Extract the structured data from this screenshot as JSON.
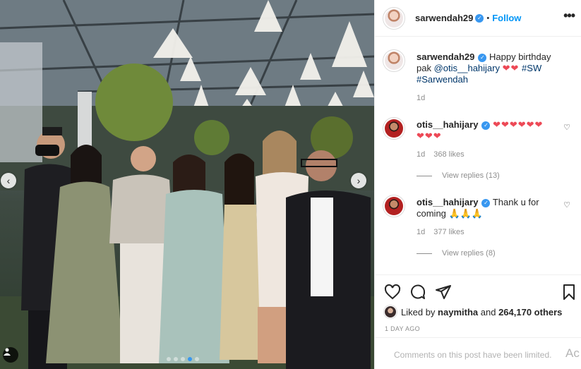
{
  "post": {
    "username": "sarwendah29",
    "separator": "•",
    "follow_label": "Follow",
    "more_icon": "more-options-icon"
  },
  "carousel": {
    "prev_glyph": "‹",
    "next_glyph": "›",
    "slide_count": 5,
    "active_index": 3
  },
  "comments": [
    {
      "username": "sarwendah29",
      "text_prefix": "Happy birthday pak ",
      "mention": "@otis__hahijary",
      "hearts": "❤❤",
      "hashtags": "#SW #Sarwendah",
      "time": "1d"
    },
    {
      "username": "otis__hahijary",
      "hearts": "❤❤❤❤❤❤❤❤❤",
      "time": "1d",
      "likes": "368 likes",
      "replies": "View replies (13)"
    },
    {
      "username": "otis__hahijary",
      "text": "Thank u for coming",
      "emoji": "🙏🙏🙏",
      "time": "1d",
      "likes": "377 likes",
      "replies": "View replies (8)"
    }
  ],
  "engagement": {
    "liked_by_prefix": "Liked by",
    "liked_by_user": "naymitha",
    "liked_by_and": "and",
    "others": "264,170 others",
    "time_ago": "1 DAY AGO"
  },
  "comment_box": {
    "limited_text": "Comments on this post have been limited."
  },
  "watermark": "Ac",
  "colors": {
    "link_blue": "#0095f6",
    "verified_blue": "#3897f0",
    "heart_red": "#ed4956",
    "muted_gray": "#8e8e8e"
  }
}
